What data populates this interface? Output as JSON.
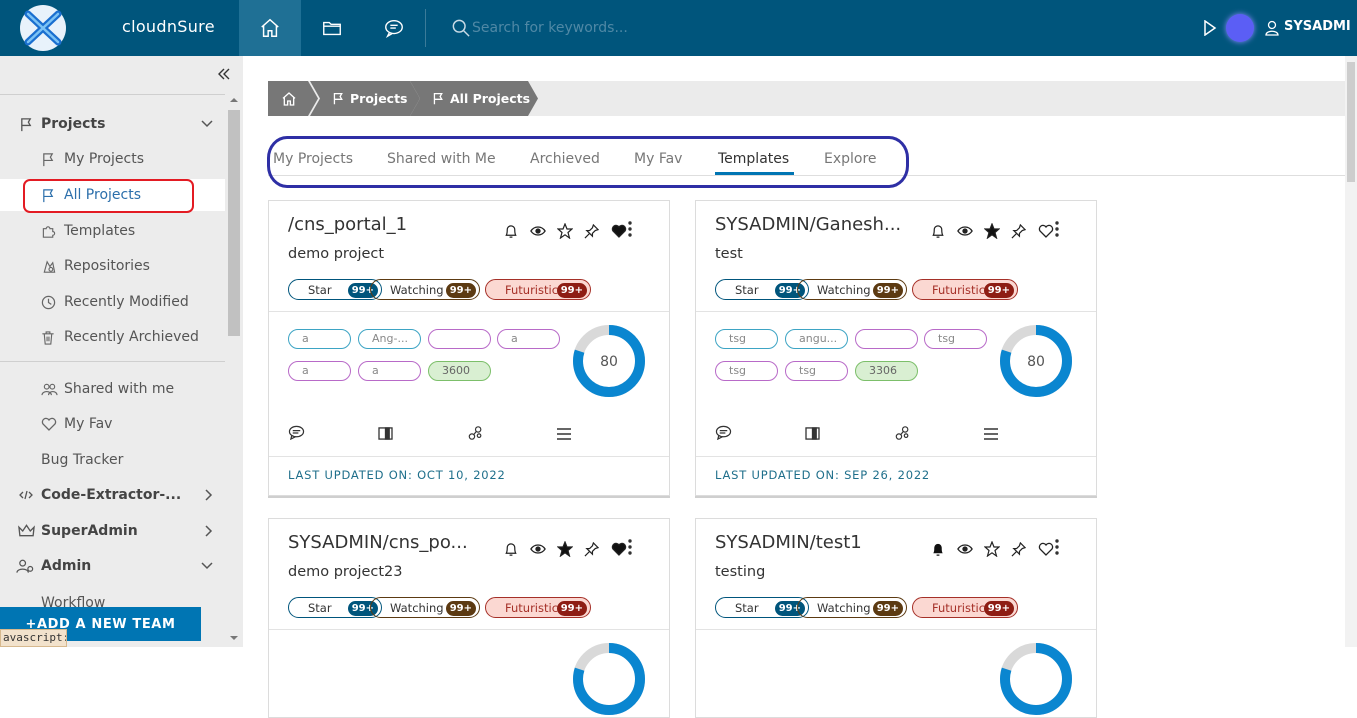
{
  "header": {
    "app_name": "cloudnSure",
    "search_placeholder": "Search for keywords...",
    "username": "SYSADMI",
    "nav": [
      {
        "icon": "home-icon",
        "active": true
      },
      {
        "icon": "folder-icon",
        "active": false
      },
      {
        "icon": "chat-icon",
        "active": false
      }
    ],
    "colors": {
      "bar": "#00557c",
      "active": "#1f7095",
      "avatar": "#5b5ef5"
    }
  },
  "sidebar": {
    "items": [
      {
        "label": "Projects",
        "icon": "flag-icon"
      },
      {
        "label": "My Projects",
        "icon": "flag-icon"
      },
      {
        "label": "All Projects",
        "icon": "flag-icon"
      },
      {
        "label": "Templates",
        "icon": "puzzle-icon"
      },
      {
        "label": "Repositories",
        "icon": "repository-icon"
      },
      {
        "label": "Recently Modified",
        "icon": "clock-icon"
      },
      {
        "label": "Recently Archieved",
        "icon": "trash-icon"
      },
      {
        "label": "Shared with me",
        "icon": "users-icon"
      },
      {
        "label": "My Fav",
        "icon": "heart-icon"
      },
      {
        "label": "Bug Tracker",
        "icon": ""
      },
      {
        "label": "Code-Extractor-...",
        "icon": "code-icon"
      },
      {
        "label": "SuperAdmin",
        "icon": "crown-icon"
      },
      {
        "label": "Admin",
        "icon": "gear-users-icon"
      },
      {
        "label": "Workflow",
        "icon": ""
      }
    ],
    "add_team_label": "+ADD A NEW TEAM",
    "status_text": "avascript://"
  },
  "breadcrumb": {
    "items": [
      "Projects",
      "All Projects"
    ]
  },
  "tabs": [
    "My Projects",
    "Shared with Me",
    "Archieved",
    "My Fav",
    "Templates",
    "Explore"
  ],
  "active_tab": "Templates",
  "cards": [
    {
      "title": "/cns_portal_1",
      "description": "demo project",
      "star_label": "Star",
      "star_count": "99+",
      "watch_label": "Watching",
      "watch_count": "99+",
      "fut_label": "Futuristic",
      "fut_count": "99+",
      "tags": [
        "a",
        "Ang-...",
        "",
        "a",
        "a",
        "a",
        "3600"
      ],
      "progress": 80,
      "progress_label": "80",
      "updated": "LAST UPDATED ON: OCT 10, 2022"
    },
    {
      "title": "SYSADMIN/Ganesh...",
      "description": "test",
      "star_label": "Star",
      "star_count": "99+",
      "watch_label": "Watching",
      "watch_count": "99+",
      "fut_label": "Futuristic",
      "fut_count": "99+",
      "tags": [
        "tsg",
        "angu...",
        "",
        "tsg",
        "tsg",
        "tsg",
        "3306"
      ],
      "progress": 80,
      "progress_label": "80",
      "updated": "LAST UPDATED ON: SEP 26, 2022"
    },
    {
      "title": "SYSADMIN/cns_po...",
      "description": "demo project23",
      "star_label": "Star",
      "star_count": "99+",
      "watch_label": "Watching",
      "watch_count": "99+",
      "fut_label": "Futuristic",
      "fut_count": "99+"
    },
    {
      "title": "SYSADMIN/test1",
      "description": "testing",
      "star_label": "Star",
      "star_count": "99+",
      "watch_label": "Watching",
      "watch_count": "99+",
      "fut_label": "Futuristic",
      "fut_count": "99+"
    }
  ]
}
